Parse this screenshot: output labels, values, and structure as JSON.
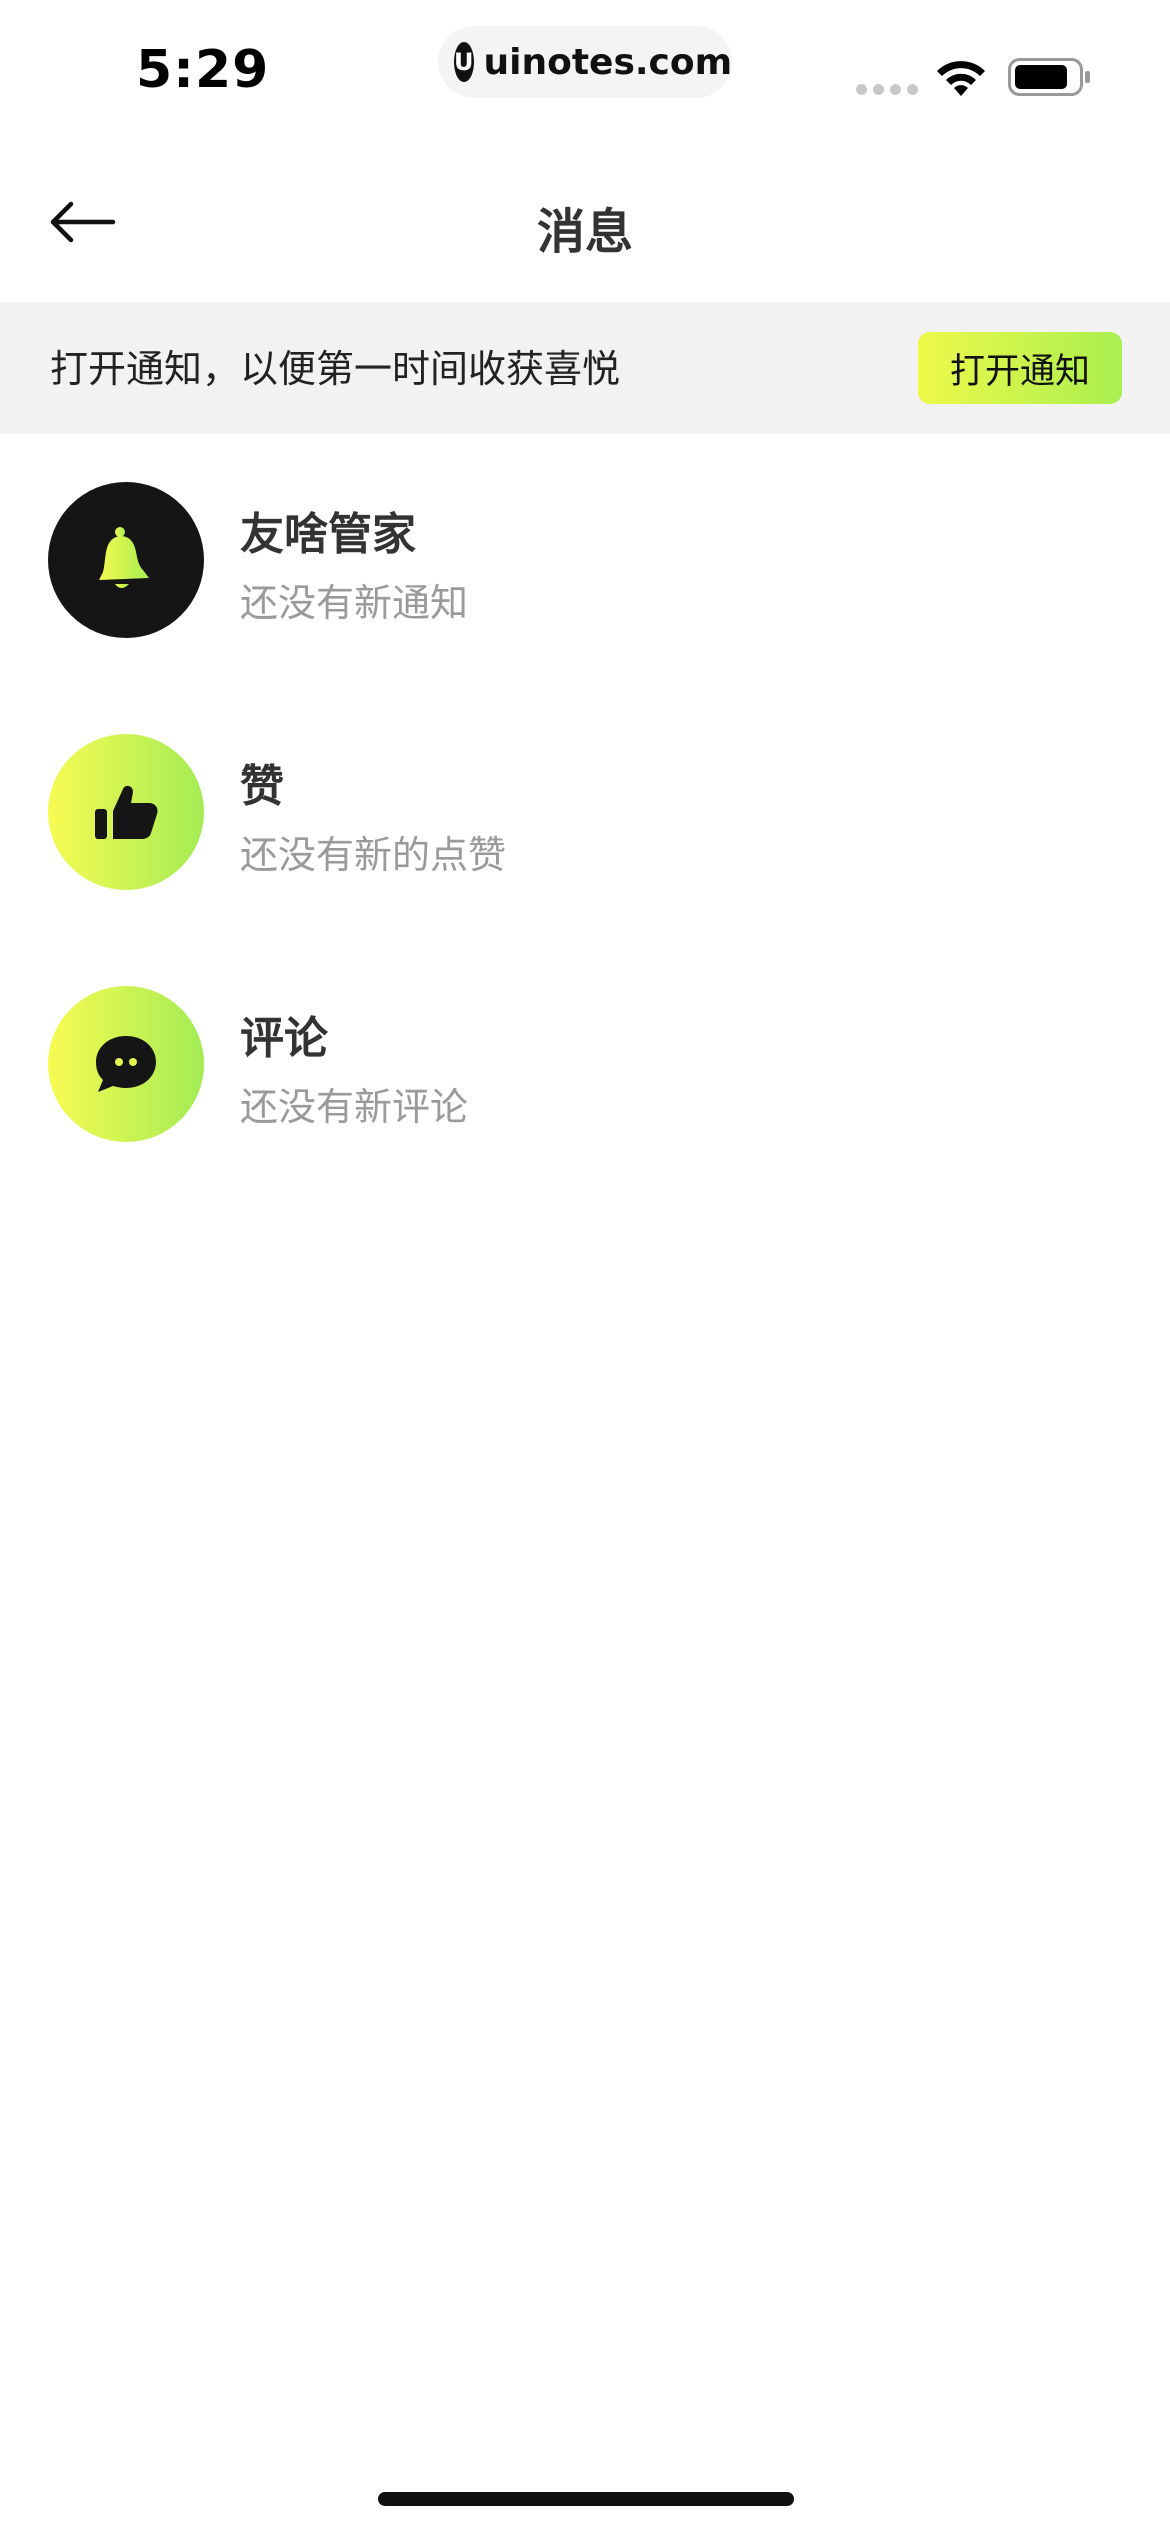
{
  "status_bar": {
    "time": "5:29",
    "url": "uinotes.com",
    "logo_glyph": "U"
  },
  "nav": {
    "title": "消息",
    "back_icon": "arrow-left-icon"
  },
  "notice": {
    "text": "打开通知，以便第一时间收获喜悦",
    "button_label": "打开通知"
  },
  "messages": [
    {
      "title": "友啥管家",
      "subtitle": "还没有新通知",
      "icon": "bell-icon"
    },
    {
      "title": "赞",
      "subtitle": "还没有新的点赞",
      "icon": "thumbs-up-icon"
    },
    {
      "title": "评论",
      "subtitle": "还没有新评论",
      "icon": "chat-bubble-icon"
    }
  ],
  "colors": {
    "accent_start": "#eef94a",
    "accent_end": "#a9ef4f",
    "dark_avatar": "#151515",
    "subtitle_gray": "#9a9a9a",
    "banner_bg": "#f2f2f2"
  }
}
